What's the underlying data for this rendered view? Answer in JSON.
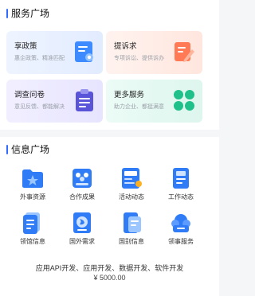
{
  "service": {
    "title": "服务广场",
    "cards": [
      {
        "title": "享政策",
        "subtitle": "惠企政策、精准匹配",
        "icon": "policy-doc-icon",
        "color": "#3d8bff"
      },
      {
        "title": "提诉求",
        "subtitle": "专项诉讼、提供诉办",
        "icon": "edit-pen-icon",
        "color": "#ff7a55"
      },
      {
        "title": "调查问卷",
        "subtitle": "意见反馈、都能解决",
        "icon": "clipboard-icon",
        "color": "#5a55d8"
      },
      {
        "title": "更多服务",
        "subtitle": "助力企业、都挺满意",
        "icon": "clover-grid-icon",
        "color": "#20c08a"
      }
    ]
  },
  "info": {
    "title": "信息广场",
    "items": [
      {
        "label": "外事资源",
        "icon": "folder-star-icon"
      },
      {
        "label": "合作成果",
        "icon": "team-icon"
      },
      {
        "label": "活动动态",
        "icon": "activity-doc-icon"
      },
      {
        "label": "工作动态",
        "icon": "work-report-icon"
      },
      {
        "label": "领馆信息",
        "icon": "consulate-doc-icon"
      },
      {
        "label": "国外需求",
        "icon": "globe-doc-icon"
      },
      {
        "label": "国别信息",
        "icon": "country-doc-icon"
      },
      {
        "label": "领事服务",
        "icon": "service-cloud-icon"
      }
    ]
  },
  "footer": {
    "text": "应用API开发、应用开发、数据开发、软件开发",
    "price": "¥ 5000.00"
  }
}
